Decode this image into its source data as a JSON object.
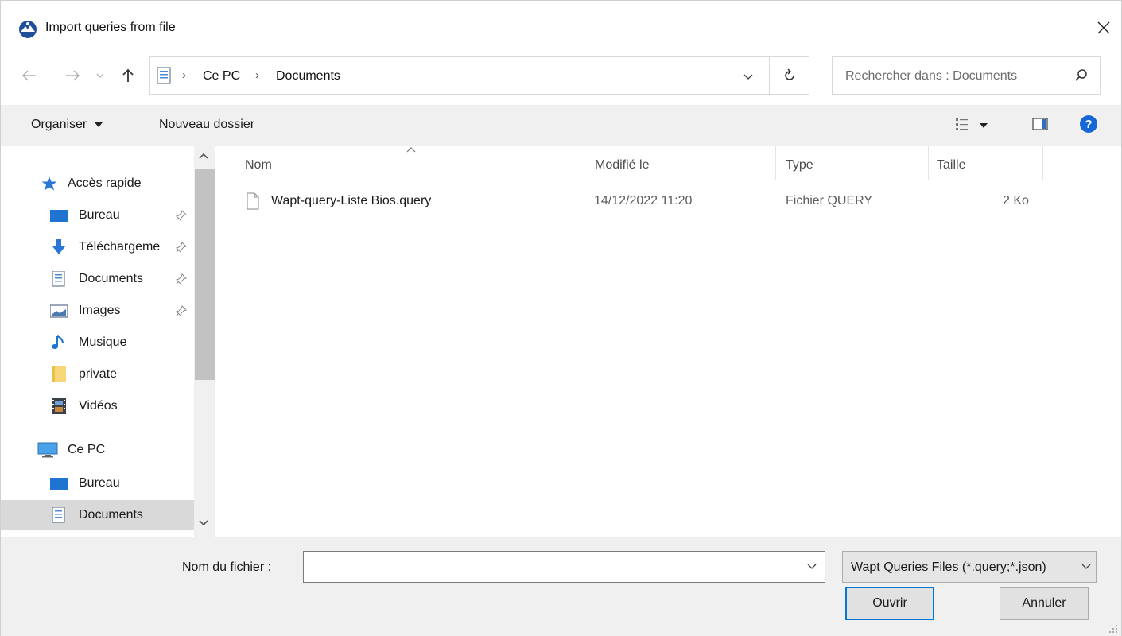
{
  "window": {
    "title": "Import queries from file"
  },
  "address": {
    "crumbs": [
      "Ce PC",
      "Documents"
    ],
    "separator": "›"
  },
  "search": {
    "placeholder": "Rechercher dans : Documents"
  },
  "toolbar": {
    "organize_label": "Organiser",
    "new_folder_label": "Nouveau dossier"
  },
  "sidebar": {
    "items": [
      {
        "label": "Accès rapide",
        "icon": "star-icon",
        "pinned": false
      },
      {
        "label": "Bureau",
        "icon": "desktop-icon",
        "pinned": true
      },
      {
        "label": "Téléchargeme",
        "icon": "download-icon",
        "pinned": true
      },
      {
        "label": "Documents",
        "icon": "documents-icon",
        "pinned": true
      },
      {
        "label": "Images",
        "icon": "images-icon",
        "pinned": true
      },
      {
        "label": "Musique",
        "icon": "music-icon",
        "pinned": false
      },
      {
        "label": "private",
        "icon": "folder-icon",
        "pinned": false
      },
      {
        "label": "Vidéos",
        "icon": "videos-icon",
        "pinned": false
      },
      {
        "label": "Ce PC",
        "icon": "computer-icon",
        "pinned": false
      },
      {
        "label": "Bureau",
        "icon": "desktop-icon",
        "pinned": false
      },
      {
        "label": "Documents",
        "icon": "documents-icon",
        "pinned": false,
        "selected": true
      }
    ]
  },
  "file_list": {
    "columns": [
      "Nom",
      "Modifié le",
      "Type",
      "Taille"
    ],
    "rows": [
      {
        "name": "Wapt-query-Liste Bios.query",
        "modified": "14/12/2022 11:20",
        "type": "Fichier QUERY",
        "size": "2 Ko"
      }
    ]
  },
  "footer": {
    "filename_label": "Nom du fichier :",
    "filename_value": "",
    "filter_value": "Wapt Queries Files (*.query;*.json)",
    "open_label": "Ouvrir",
    "cancel_label": "Annuler"
  },
  "colors": {
    "accent": "#0078d7",
    "toolbar_bg": "#f0f0f0",
    "selected_bg": "#d9d9d9"
  }
}
